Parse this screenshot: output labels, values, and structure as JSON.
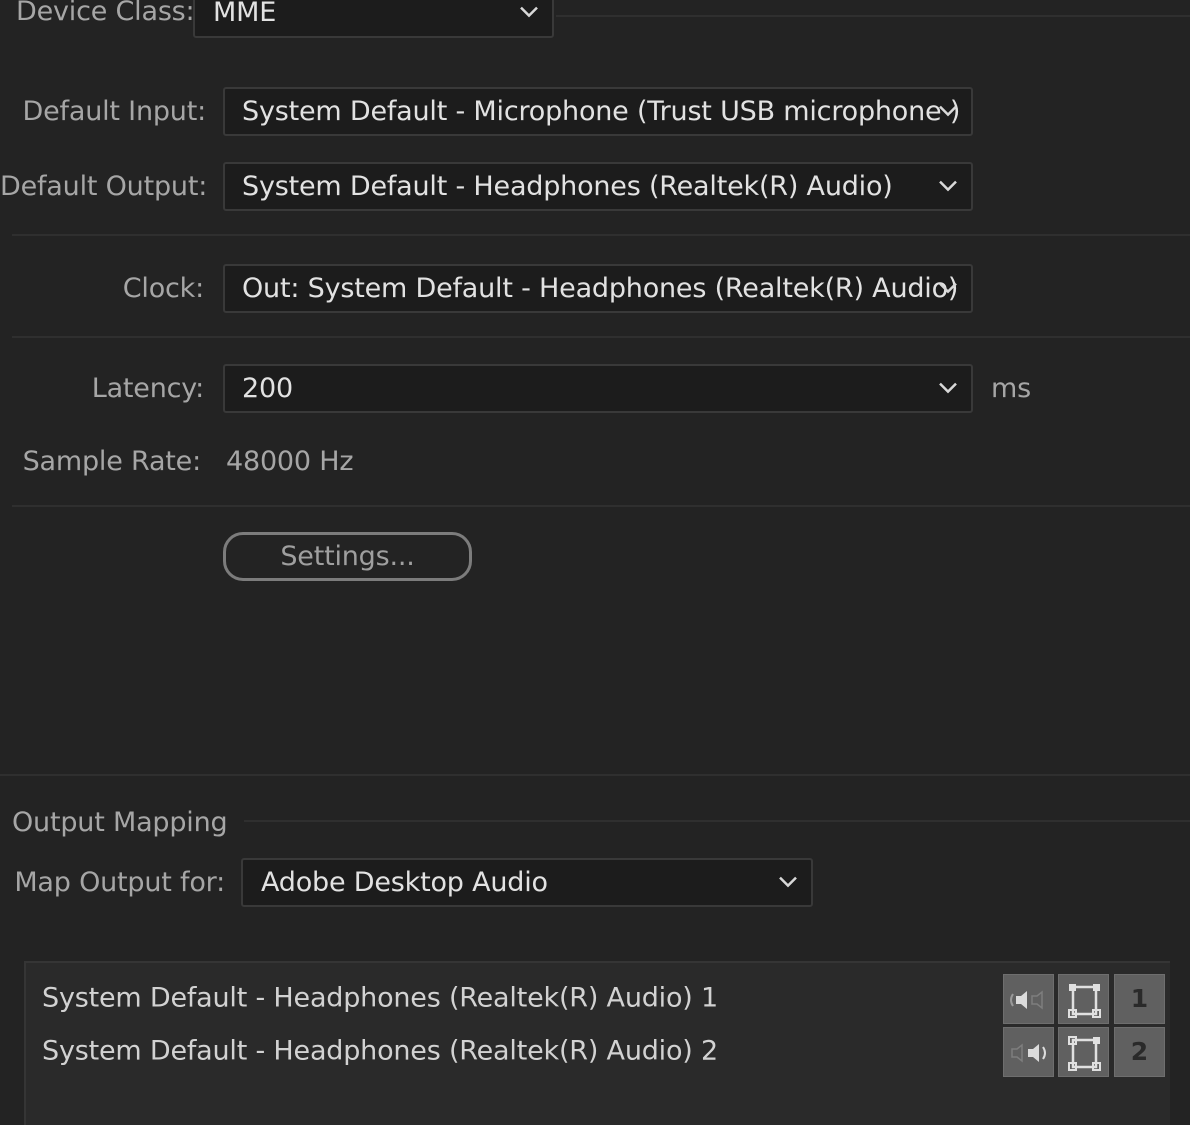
{
  "device_class": {
    "label": "Device Class:",
    "value": "MME"
  },
  "default_input": {
    "label": "Default Input:",
    "value": "System Default - Microphone (Trust USB microphone )"
  },
  "default_output": {
    "label": "Default Output:",
    "value": "System Default - Headphones (Realtek(R) Audio)"
  },
  "clock": {
    "label": "Clock:",
    "value": "Out: System Default - Headphones (Realtek(R) Audio)"
  },
  "latency": {
    "label": "Latency:",
    "value": "200",
    "unit": "ms"
  },
  "sample_rate": {
    "label": "Sample Rate:",
    "value": "48000 Hz"
  },
  "settings_button": {
    "label": "Settings..."
  },
  "output_mapping": {
    "section_title": "Output Mapping",
    "map_for_label": "Map Output for:",
    "map_for_value": "Adobe Desktop Audio",
    "rows": [
      {
        "label": "System Default - Headphones (Realtek(R) Audio) 1",
        "channel_number": "1",
        "speaker_icon": "left-speaker-icon"
      },
      {
        "label": "System Default - Headphones (Realtek(R) Audio) 2",
        "channel_number": "2",
        "speaker_icon": "right-speaker-icon"
      }
    ]
  },
  "colors": {
    "background": "#232323",
    "field_background": "#1c1c1c",
    "tile_background": "#606060",
    "label_text": "#a6a6a6",
    "value_text": "#e2e2e2"
  }
}
